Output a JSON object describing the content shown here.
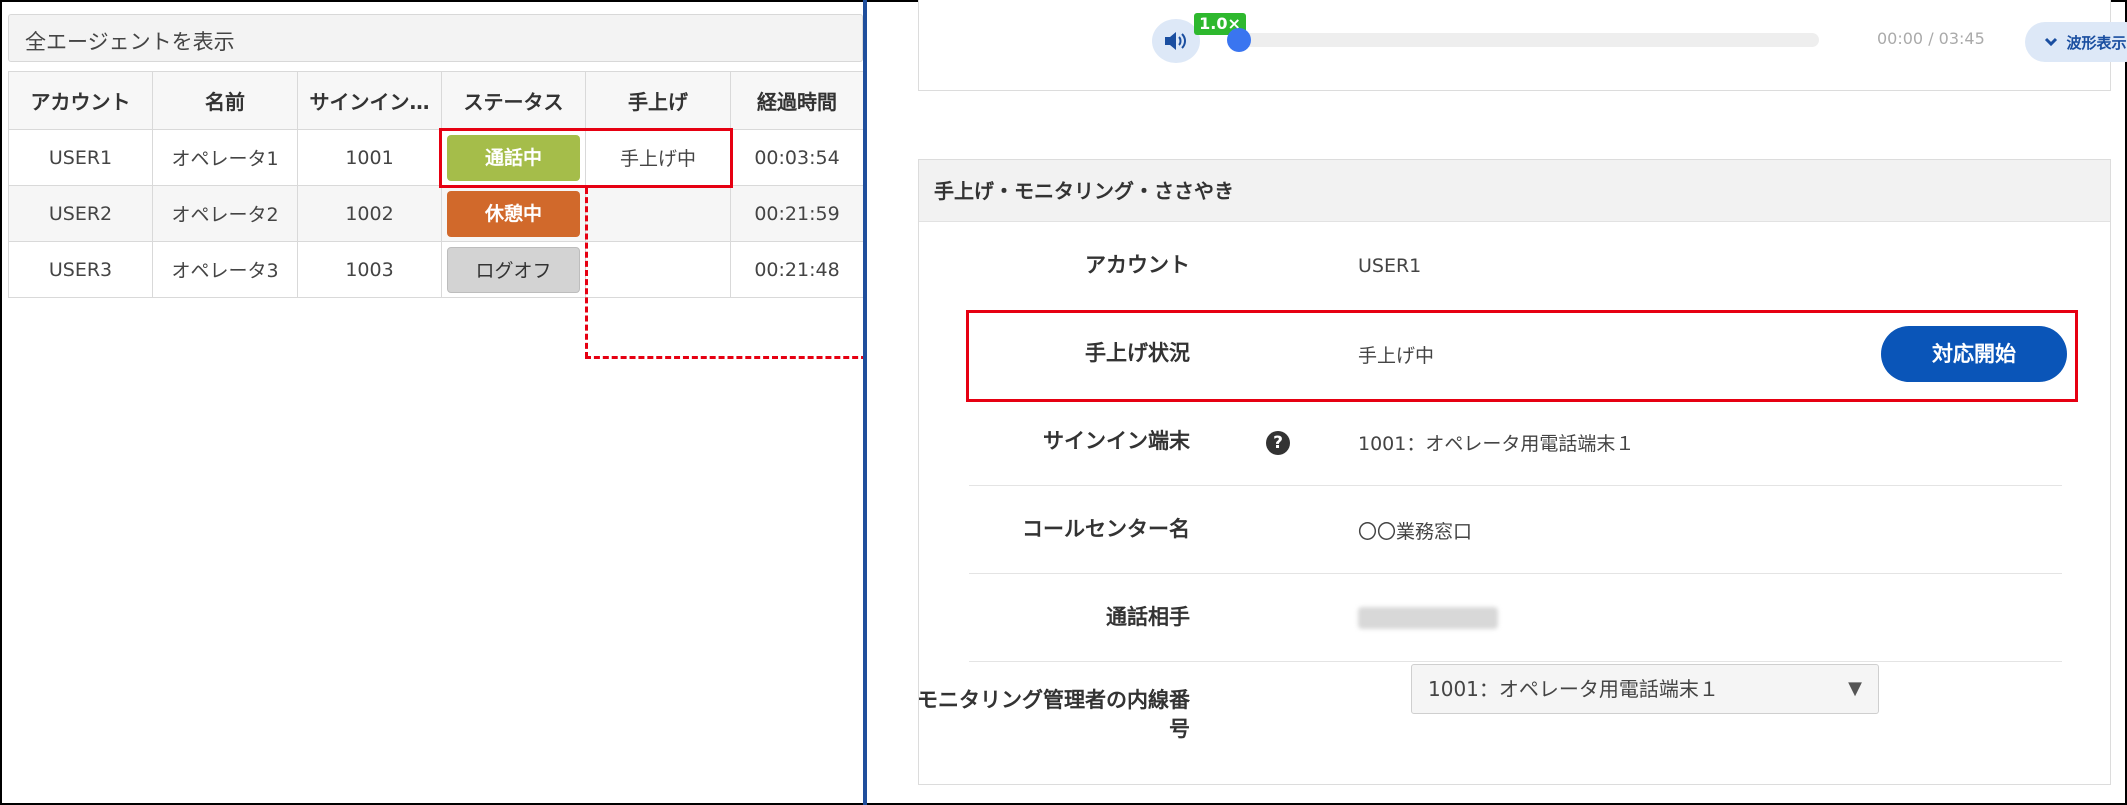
{
  "left_panel": {
    "filter_label": "全エージェントを表示",
    "columns": [
      "アカウント",
      "名前",
      "サインイン…",
      "ステータス",
      "手上げ",
      "経過時間"
    ],
    "rows": [
      {
        "account": "USER1",
        "name": "オペレータ1",
        "signin": "1001",
        "status": "通話中",
        "hand": "手上げ中",
        "elapsed": "00:03:54"
      },
      {
        "account": "USER2",
        "name": "オペレータ2",
        "signin": "1002",
        "status": "休憩中",
        "hand": "",
        "elapsed": "00:21:59"
      },
      {
        "account": "USER3",
        "name": "オペレータ3",
        "signin": "1003",
        "status": "ログオフ",
        "hand": "",
        "elapsed": "00:21:48"
      }
    ]
  },
  "player": {
    "volume_icon": "volume-icon",
    "speed": "1.0×",
    "time": "00:00 / 03:45",
    "waveform_label": "波形表示",
    "progress": 0
  },
  "monitoring": {
    "title": "手上げ・モニタリング・ささやき",
    "account_label": "アカウント",
    "account_value": "USER1",
    "hand_label": "手上げ状況",
    "hand_value": "手上げ中",
    "start_button": "対応開始",
    "signin_label": "サインイン端末",
    "signin_value": "1001：オペレータ用電話端末１",
    "callcenter_label": "コールセンター名",
    "callcenter_value": "〇〇業務窓口",
    "partner_label": "通話相手",
    "monitor_ext_label": "モニタリング管理者の内線番号",
    "monitor_ext_value": "1001：オペレータ用電話端末１"
  },
  "colors": {
    "accent": "#0a55b8",
    "highlight": "#e60012",
    "status_talk": "#a5bd4a",
    "status_break": "#d1692b",
    "status_logoff": "#d3d3d3"
  }
}
